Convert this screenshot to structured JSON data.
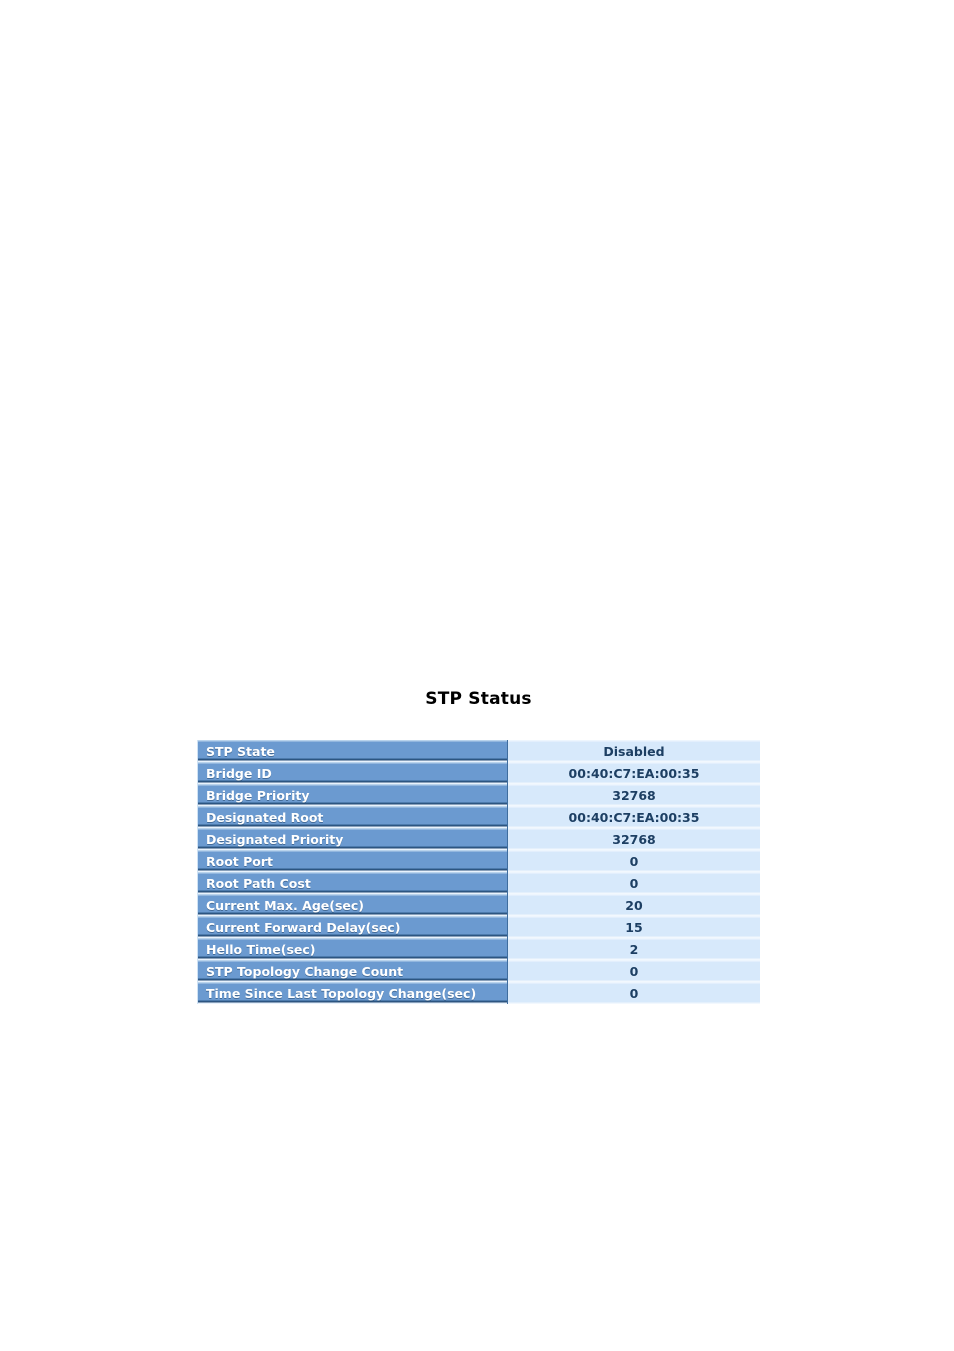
{
  "page": {
    "title": "STP Status",
    "background_color": "#ffffff"
  },
  "theme": {
    "label_cell_color": "#6699cc",
    "label_cell_highlight": "#b9d3ec",
    "label_cell_shadow": "#2a4f77",
    "label_text_color": "#ffffff",
    "value_cell_color": "#d7e9fb",
    "value_text_color": "#1d3f63",
    "title_text_color": "#000000"
  },
  "stp_status_table": {
    "rows": [
      {
        "label": "STP State",
        "value": "Disabled"
      },
      {
        "label": "Bridge ID",
        "value": "00:40:C7:EA:00:35"
      },
      {
        "label": "Bridge Priority",
        "value": "32768"
      },
      {
        "label": "Designated Root",
        "value": "00:40:C7:EA:00:35"
      },
      {
        "label": "Designated Priority",
        "value": "32768"
      },
      {
        "label": "Root Port",
        "value": "0"
      },
      {
        "label": "Root Path Cost",
        "value": "0"
      },
      {
        "label": "Current Max. Age(sec)",
        "value": "20"
      },
      {
        "label": "Current Forward Delay(sec)",
        "value": "15"
      },
      {
        "label": "Hello Time(sec)",
        "value": "2"
      },
      {
        "label": "STP Topology Change Count",
        "value": "0"
      },
      {
        "label": "Time Since Last Topology Change(sec)",
        "value": "0"
      }
    ]
  }
}
